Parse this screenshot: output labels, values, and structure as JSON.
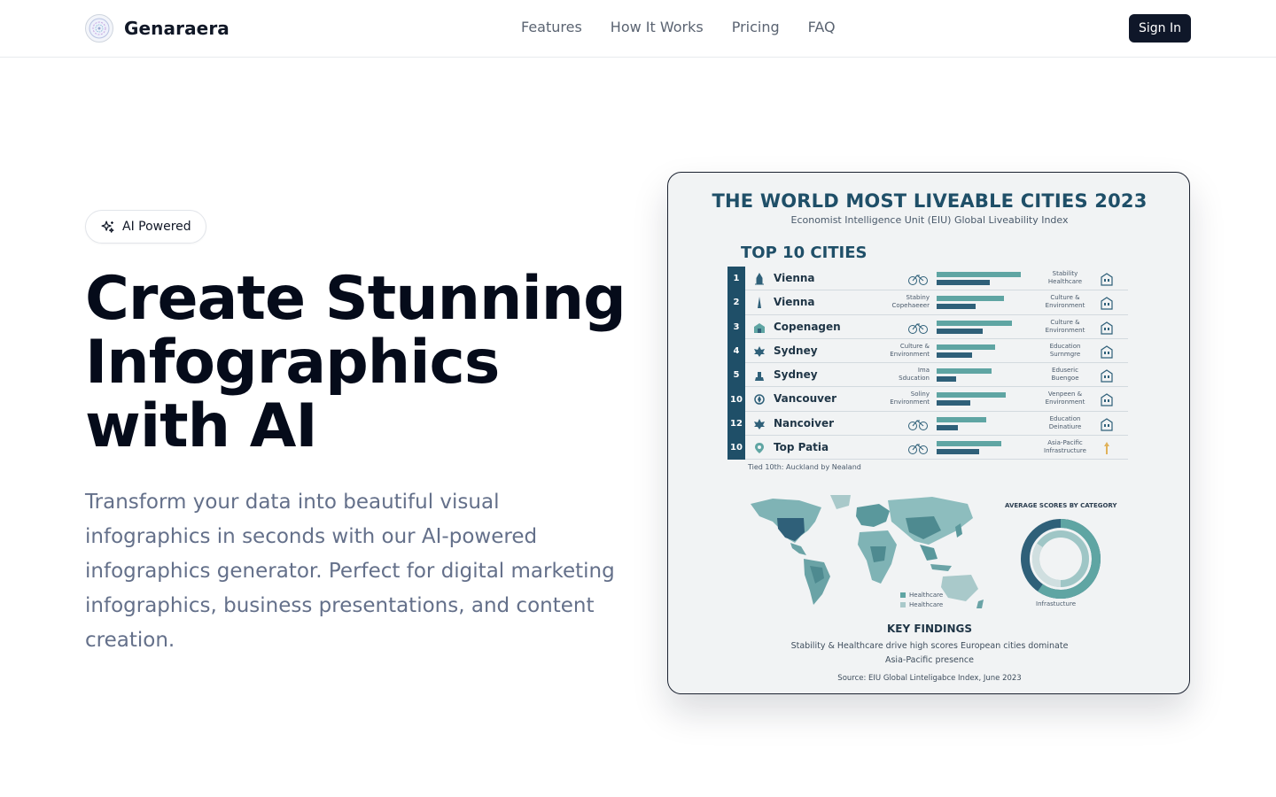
{
  "header": {
    "brand_name": "Genaraera",
    "nav": [
      "Features",
      "How It Works",
      "Pricing",
      "FAQ"
    ],
    "signin_label": "Sign In"
  },
  "hero": {
    "badge": "AI Powered",
    "title_lines": [
      "Create Stunning",
      "Infographics",
      "with AI"
    ],
    "description": "Transform your data into beautiful visual infographics in seconds with our AI-powered infographics generator. Perfect for digital marketing infographics, business presentations, and content creation."
  },
  "infographic": {
    "title": "THE WORLD MOST LIVEABLE CITIES 2023",
    "subtitle": "Economist Intelligence Unit (EIU) Global Liveability Index",
    "section_title": "TOP 10 CITIES",
    "rows": [
      {
        "rank": "1",
        "city": "Vienna",
        "label1": "",
        "label2": "Stability\nHealthcare",
        "bar1": 0.95,
        "bar2": 0.6
      },
      {
        "rank": "2",
        "city": "Vienna",
        "label1": "Stabiny\nCopehaeeer",
        "label2": "Culture &\nEnvironment",
        "bar1": 0.76,
        "bar2": 0.44
      },
      {
        "rank": "3",
        "city": "Copenagen",
        "label1": "",
        "label2": "Culture &\nEnvironment",
        "bar1": 0.85,
        "bar2": 0.52
      },
      {
        "rank": "4",
        "city": "Sydney",
        "label1": "Culture &\nEnvironment",
        "label2": "Education\nSurnmgre",
        "bar1": 0.66,
        "bar2": 0.4
      },
      {
        "rank": "5",
        "city": "Sydney",
        "label1": "Ima\nSducation",
        "label2": "Eduseric\nBuengoe",
        "bar1": 0.62,
        "bar2": 0.22
      },
      {
        "rank": "10",
        "city": "Vancouver",
        "label1": "Soliny\nEnvironment",
        "label2": "Venpeen &\nEnvironment",
        "bar1": 0.78,
        "bar2": 0.38
      },
      {
        "rank": "12",
        "city": "Nancoiver",
        "label1": "",
        "label2": "Education\nDeinatiure",
        "bar1": 0.56,
        "bar2": 0.24
      },
      {
        "rank": "10",
        "city": "Top Patia",
        "label1": "",
        "label2": "Asia-Pacific\nInfrastructure",
        "bar1": 0.73,
        "bar2": 0.48
      }
    ],
    "tied_note": "Tied 10th: Auckland by Nealand",
    "avg_title": "AVERAGE SCORES BY CATEGORY",
    "donut_label": "Infrastucture",
    "legend": [
      "Healthcare",
      "Healthcare"
    ],
    "key_findings_title": "KEY FINDINGS",
    "key_findings_line1": "Stability & Healthcare drive high scores  European cities dominate",
    "key_findings_line2": "Asia-Pacific presence",
    "source": "Source: EIU Global Linteligabce Index, June 2023",
    "colors": {
      "primary": "#1f4f68",
      "teal": "#5fa5a3",
      "dark_bar": "#2f6079"
    }
  }
}
